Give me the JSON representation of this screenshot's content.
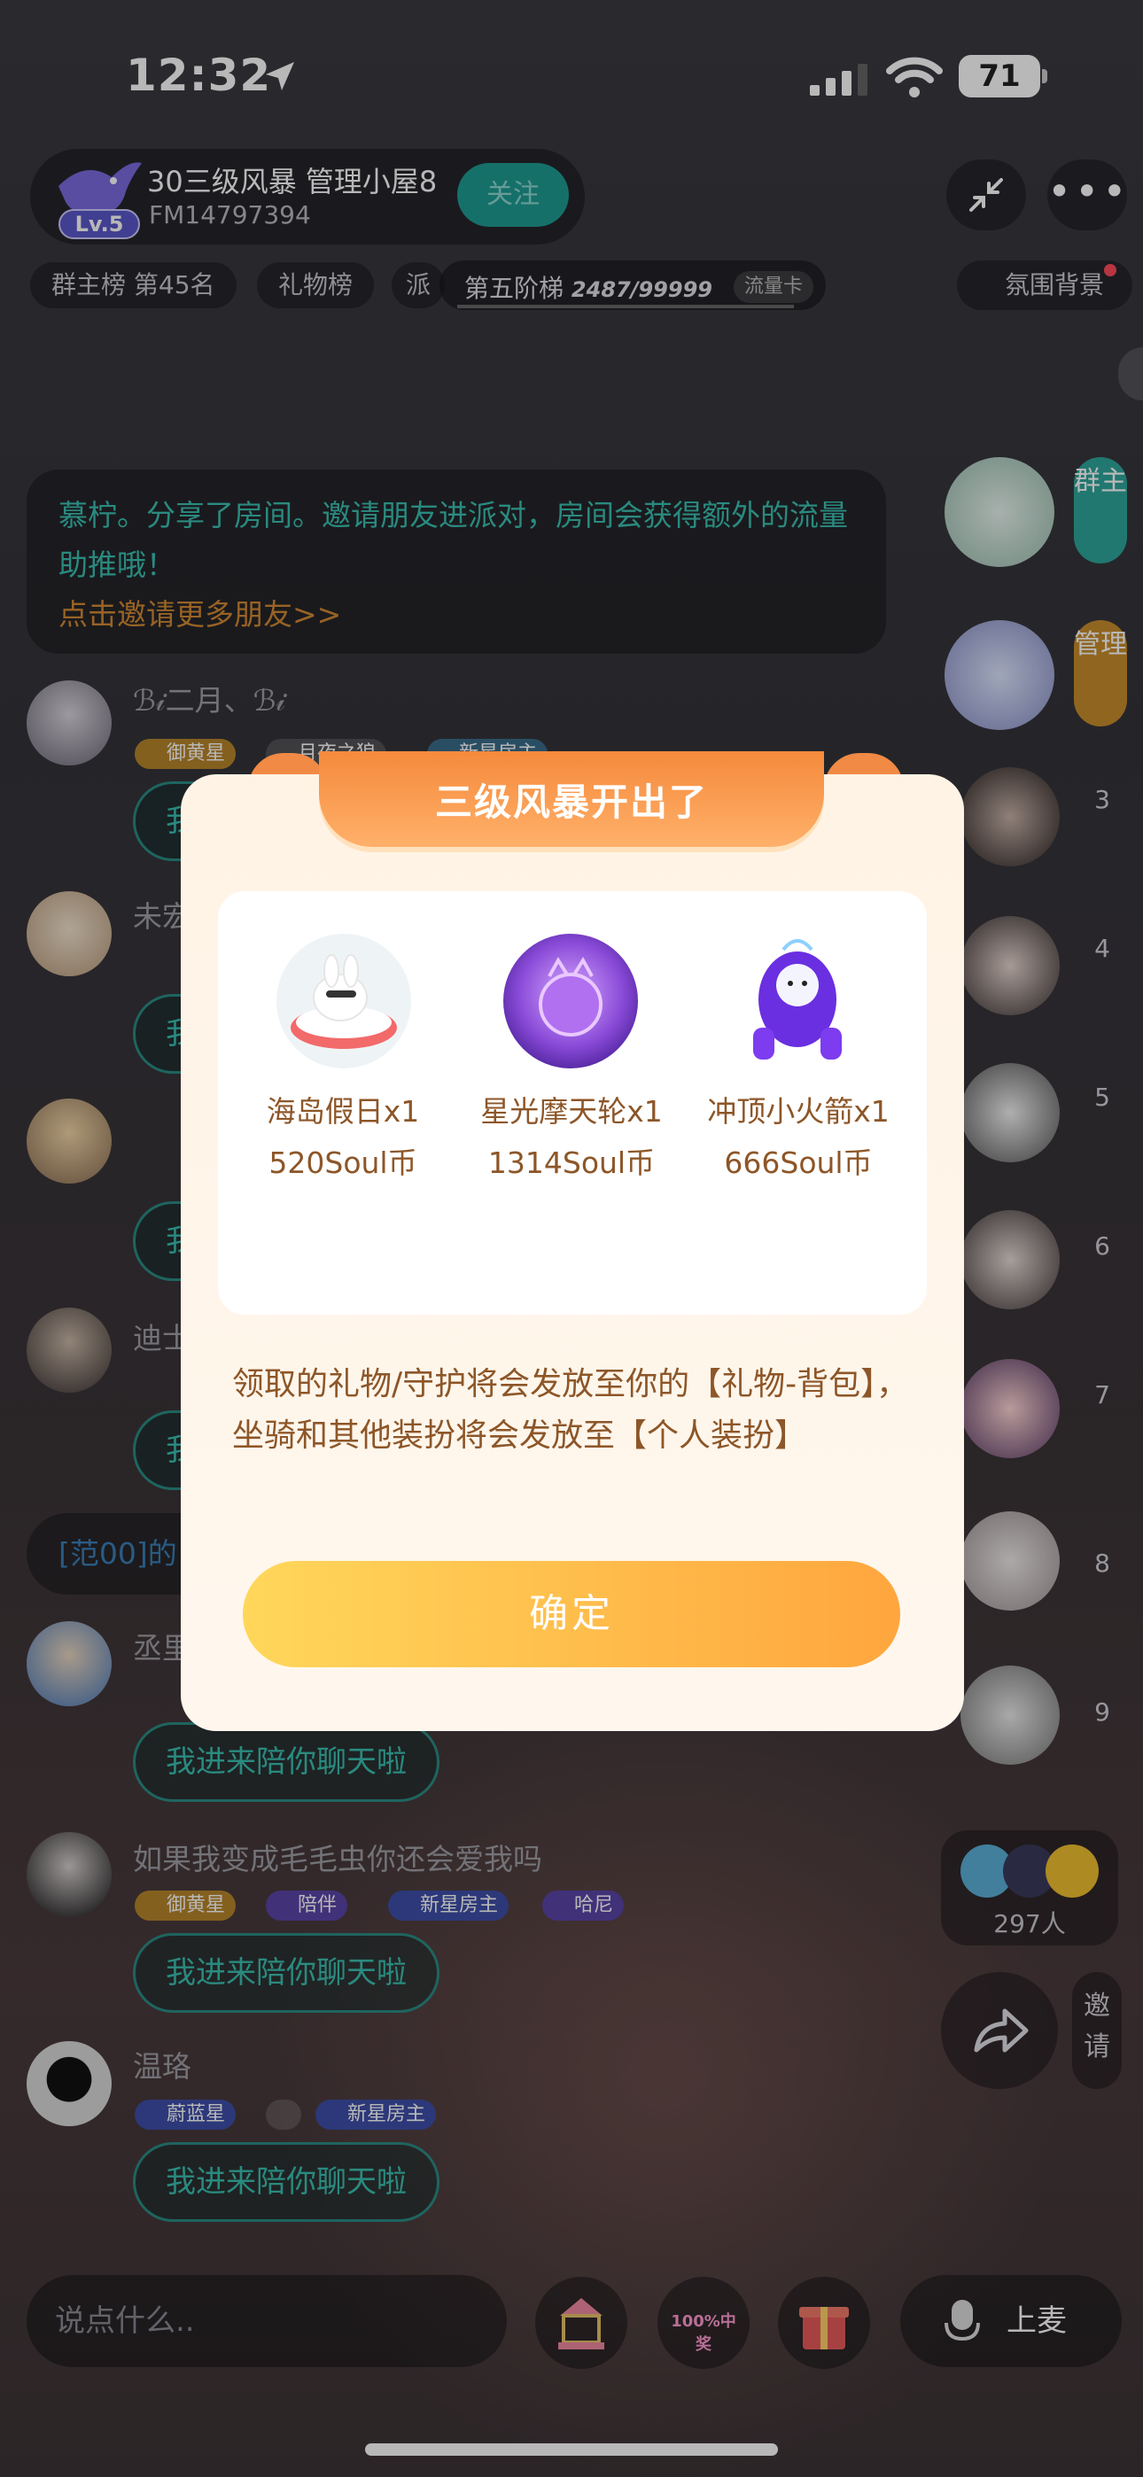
{
  "status_bar": {
    "time": "12:32",
    "battery": "71"
  },
  "room": {
    "level": "Lv.5",
    "title": "30三级风暴  管理小屋8",
    "id": "FM14797394",
    "follow_label": "关注",
    "tags": [
      "群主榜 第45名",
      "礼物榜",
      "派"
    ],
    "ladder": {
      "label": "第五阶梯",
      "progress": "2487/99999",
      "card": "流量卡"
    },
    "atmosphere_label": "氛围背景"
  },
  "chat": {
    "system_message": {
      "line1": "慕柠。分享了房间。邀请朋友进派对，房间会获得额外的流量助推哦！",
      "line2": "点击邀请更多朋友>>"
    },
    "messages": [
      {
        "name": "ℬ𝒾二月、ℬ𝒾",
        "badges": [
          "御黄星",
          "月夜之狼",
          "新星房主"
        ],
        "bubble": "我"
      },
      {
        "name": "未宏",
        "badges": [],
        "bubble": "我"
      },
      {
        "name": "",
        "badges": [],
        "bubble": "我"
      },
      {
        "name": "迪士",
        "badges": [],
        "bubble": "我"
      },
      {
        "name": "丞里",
        "badges": [],
        "bubble": "我进来陪你聊天啦"
      },
      {
        "name": "如果我变成毛毛虫你还会爱我吗",
        "badges": [
          "御黄星",
          "陪伴",
          "新星房主",
          "哈尼"
        ],
        "bubble": "我进来陪你聊天啦"
      },
      {
        "name": "温珞",
        "badges": [
          "蔚蓝星",
          "",
          "新星房主"
        ],
        "bubble": "我进来陪你聊天啦"
      }
    ],
    "notice": "[范00]的"
  },
  "seats": {
    "owner_label": "群主",
    "admin_label": "管理",
    "numbers": [
      "3",
      "4",
      "5",
      "6",
      "7",
      "8",
      "9"
    ]
  },
  "online_count": "297人",
  "invite_label": "邀请",
  "bottom": {
    "input_placeholder": "说点什么..",
    "lottery_badge": "100%中奖",
    "mic_label": "上麦"
  },
  "modal": {
    "title": "三级风暴开出了",
    "rewards": [
      {
        "name": "海岛假日x1",
        "price": "520Soul币"
      },
      {
        "name": "星光摩天轮x1",
        "price": "1314Soul币"
      },
      {
        "name": "冲顶小火箭x1",
        "price": "666Soul币"
      }
    ],
    "description": "领取的礼物/守护将会发放至你的【礼物-背包】，坐骑和其他装扮将会发放至【个人装扮】",
    "confirm_label": "确定"
  },
  "colors": {
    "accent_teal": "#3bbfb0",
    "accent_orange": "#f58a3c",
    "modal_text": "#8d5628"
  }
}
